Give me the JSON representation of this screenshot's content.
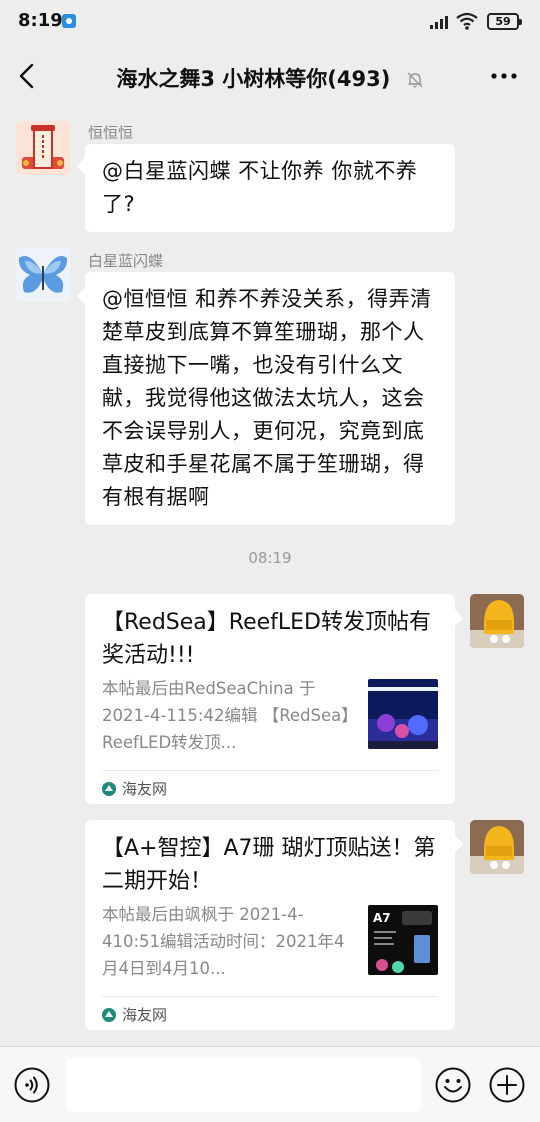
{
  "status_bar": {
    "time": "8:19",
    "battery": "59",
    "icons": [
      "app-notification-icon",
      "signal-icon",
      "wifi-icon",
      "battery-icon"
    ]
  },
  "header": {
    "title": "海水之舞3 小树林等你(493)",
    "icons": [
      "back-arrow-icon",
      "mute-bell-icon",
      "more-dots-icon"
    ]
  },
  "messages": [
    {
      "sender": "恒恒恒",
      "text": "@白星蓝闪蝶  不让你养 你就不养了?"
    },
    {
      "sender": "白星蓝闪蝶",
      "text": "@恒恒恒  和养不养没关系，得弄清楚草皮到底算不算笙珊瑚，那个人直接抛下一嘴，也没有引什么文献，我觉得他这做法太坑人，这会不会误导别人，更何况，究竟到底草皮和手星花属不属于笙珊瑚，得有根有据啊"
    }
  ],
  "time_divider": "08:19",
  "link_cards": [
    {
      "title": "【RedSea】ReefLED转发顶帖有奖活动!!!",
      "desc": "本帖最后由RedSeaChina 于2021-4-115:42编辑 【RedSea】ReefLED转发顶...",
      "source": "海友网"
    },
    {
      "title": "【A+智控】A7珊 瑚灯顶贴送！第二期开始！",
      "desc": "本帖最后由飒枫于 2021-4-410:51编辑活动时间：2021年4月4日到4月10...",
      "source": "海友网",
      "thumb_label": "A7"
    }
  ],
  "input_bar": {
    "icons": [
      "voice-icon",
      "emoji-icon",
      "plus-icon"
    ],
    "placeholder": ""
  },
  "colors": {
    "background": "#ededed",
    "bubble": "#ffffff",
    "muted_text": "#888888",
    "accent": "#2a8ee0"
  }
}
